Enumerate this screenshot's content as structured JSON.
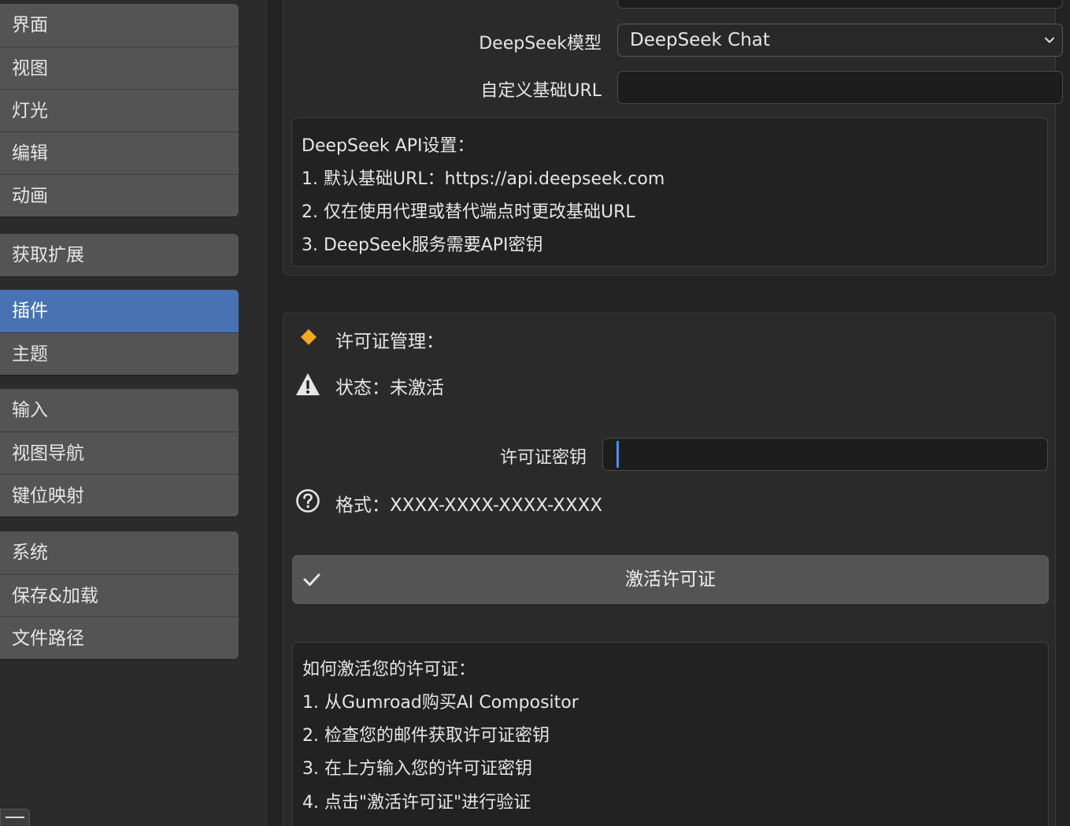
{
  "sidebar": {
    "groups": [
      {
        "items": [
          {
            "label": "界面"
          },
          {
            "label": "视图"
          },
          {
            "label": "灯光"
          },
          {
            "label": "编辑"
          },
          {
            "label": "动画"
          }
        ]
      },
      {
        "items": [
          {
            "label": "获取扩展"
          }
        ]
      },
      {
        "items": [
          {
            "label": "插件",
            "active": true
          },
          {
            "label": "主题"
          }
        ]
      },
      {
        "items": [
          {
            "label": "输入"
          },
          {
            "label": "视图导航"
          },
          {
            "label": "键位映射"
          }
        ]
      },
      {
        "items": [
          {
            "label": "系统"
          },
          {
            "label": "保存&加载"
          },
          {
            "label": "文件路径"
          }
        ]
      }
    ],
    "active_item": "插件"
  },
  "deepseek": {
    "model_label": "DeepSeek模型",
    "model_value": "DeepSeek Chat",
    "base_url_label": "自定义基础URL",
    "base_url_value": "",
    "info": {
      "title": "DeepSeek API设置：",
      "lines": [
        "1. 默认基础URL：https://api.deepseek.com",
        "2. 仅在使用代理或替代端点时更改基础URL",
        "3. DeepSeek服务需要API密钥"
      ]
    }
  },
  "license": {
    "header": "许可证管理：",
    "status": "状态：未激活",
    "key_label": "许可证密钥",
    "key_value": "",
    "format_hint": "格式：XXXX-XXXX-XXXX-XXXX",
    "activate_button": "激活许可证",
    "howto": {
      "title": "如何激活您的许可证：",
      "lines": [
        "1. 从Gumroad购买AI Compositor",
        "2. 检查您的邮件获取许可证密钥",
        "3. 在上方输入您的许可证密钥",
        "4. 点击\"激活许可证\"进行验证"
      ]
    }
  },
  "colors": {
    "accent": "#4772b3",
    "warning_diamond": "#f5a623",
    "cursor": "#4f8ce6"
  },
  "icons": {
    "header": "diamond-icon",
    "status": "warning-icon",
    "format": "question-icon",
    "activate": "checkmark-icon",
    "select": "chevron-down-icon"
  }
}
